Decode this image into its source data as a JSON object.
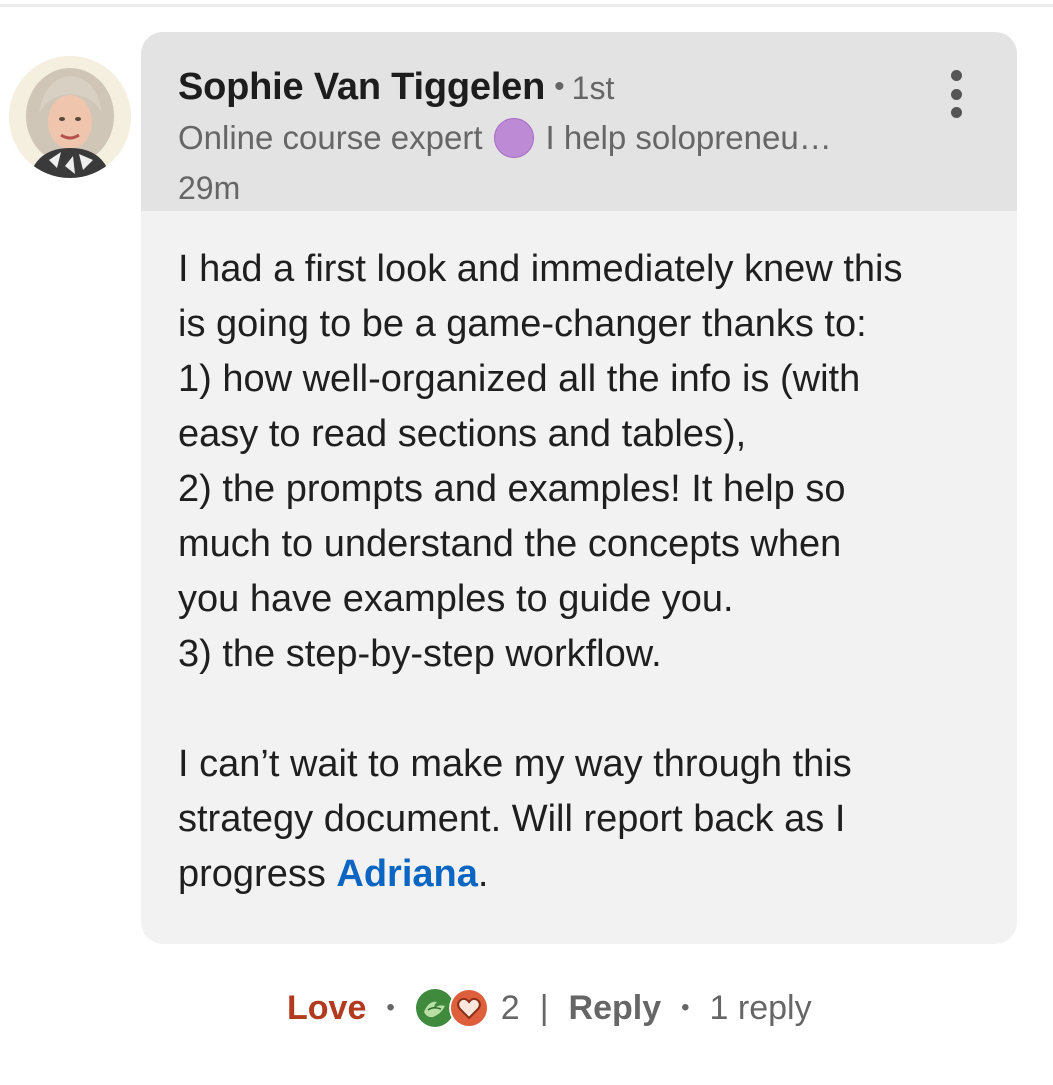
{
  "comment": {
    "author": {
      "name": "Sophie Van Tiggelen",
      "separator": "•",
      "degree": "1st",
      "headline_start": "Online course expert",
      "headline_end": "I help solopreneu…",
      "timestamp": "29m"
    },
    "body_lines": [
      "I had a first look and immediately knew this",
      "is going to be a game-changer thanks to:",
      "1) how well-organized all the info is (with",
      "easy to read sections and tables),",
      "2) the prompts and examples! It help so",
      "much to understand the concepts when",
      "you have examples to guide you.",
      "3) the step-by-step workflow.",
      "",
      "I can’t wait to make my way through this",
      "strategy document. Will report back as I"
    ],
    "last_line_prefix": "progress ",
    "mention": "Adriana",
    "last_line_suffix": "."
  },
  "actions": {
    "reaction_label": "Love",
    "bullet": "•",
    "reaction_count": "2",
    "divider": "|",
    "reply_label": "Reply",
    "reply_count": "1 reply"
  },
  "colors": {
    "mention": "#0a66c2",
    "love_reaction": "#b23a1e",
    "header_background": "#e3e3e3",
    "card_background": "#f2f2f2",
    "purple_circle": "#bd8ad6"
  },
  "icons": {
    "headline_emoji": "purple-circle-icon",
    "reaction_1": "support-reaction-icon",
    "reaction_2": "love-reaction-icon",
    "overflow_menu": "more-vertical-icon"
  }
}
